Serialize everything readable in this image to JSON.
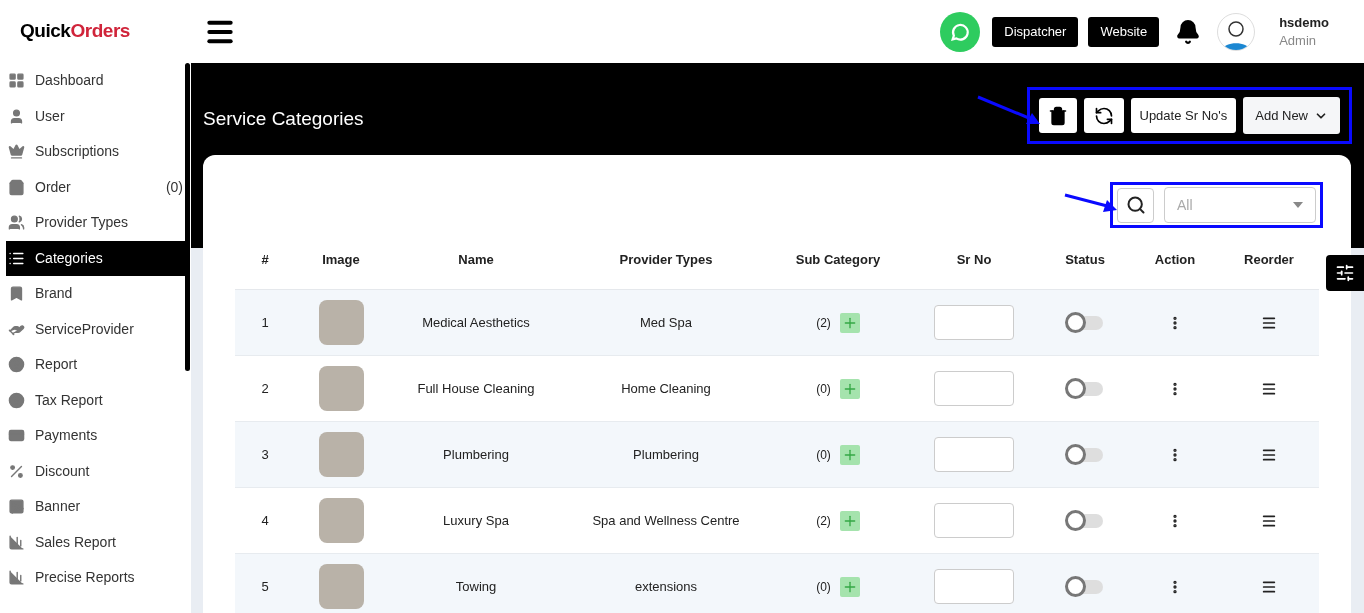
{
  "logo": {
    "first": "Quick",
    "second": "Orders"
  },
  "sidebar": {
    "items": [
      {
        "label": "Dashboard",
        "selected": false
      },
      {
        "label": "User",
        "selected": false
      },
      {
        "label": "Subscriptions",
        "selected": false
      },
      {
        "label": "Order",
        "selected": false,
        "count": "(0)"
      },
      {
        "label": "Provider Types",
        "selected": false
      },
      {
        "label": "Categories",
        "selected": true
      },
      {
        "label": "Brand",
        "selected": false
      },
      {
        "label": "ServiceProvider",
        "selected": false
      },
      {
        "label": "Report",
        "selected": false
      },
      {
        "label": "Tax Report",
        "selected": false
      },
      {
        "label": "Payments",
        "selected": false
      },
      {
        "label": "Discount",
        "selected": false
      },
      {
        "label": "Banner",
        "selected": false
      },
      {
        "label": "Sales Report",
        "selected": false
      },
      {
        "label": "Precise Reports",
        "selected": false
      }
    ]
  },
  "header": {
    "buttons": [
      "Dispatcher",
      "Website"
    ],
    "user": {
      "name": "hsdemo",
      "role": "Admin"
    }
  },
  "page": {
    "title": "Service Categories",
    "update_button": "Update Sr No's",
    "add_button": "Add New"
  },
  "filter": {
    "value": "All"
  },
  "table": {
    "columns": [
      "#",
      "Image",
      "Name",
      "Provider Types",
      "Sub Category",
      "Sr No",
      "Status",
      "Action",
      "Reorder"
    ],
    "rows": [
      {
        "number": "1",
        "name": "Medical Aesthetics",
        "provider_type": "Med Spa",
        "sub_count": "(2)",
        "on": false
      },
      {
        "number": "2",
        "name": "Full House Cleaning",
        "provider_type": "Home Cleaning",
        "sub_count": "(0)",
        "on": false
      },
      {
        "number": "3",
        "name": "Plumbering",
        "provider_type": "Plumbering",
        "sub_count": "(0)",
        "on": false
      },
      {
        "number": "4",
        "name": "Luxury Spa",
        "provider_type": "Spa and Wellness Centre",
        "sub_count": "(2)",
        "on": false
      },
      {
        "number": "5",
        "name": "Towing",
        "provider_type": "extensions",
        "sub_count": "(0)",
        "on": false
      }
    ]
  }
}
